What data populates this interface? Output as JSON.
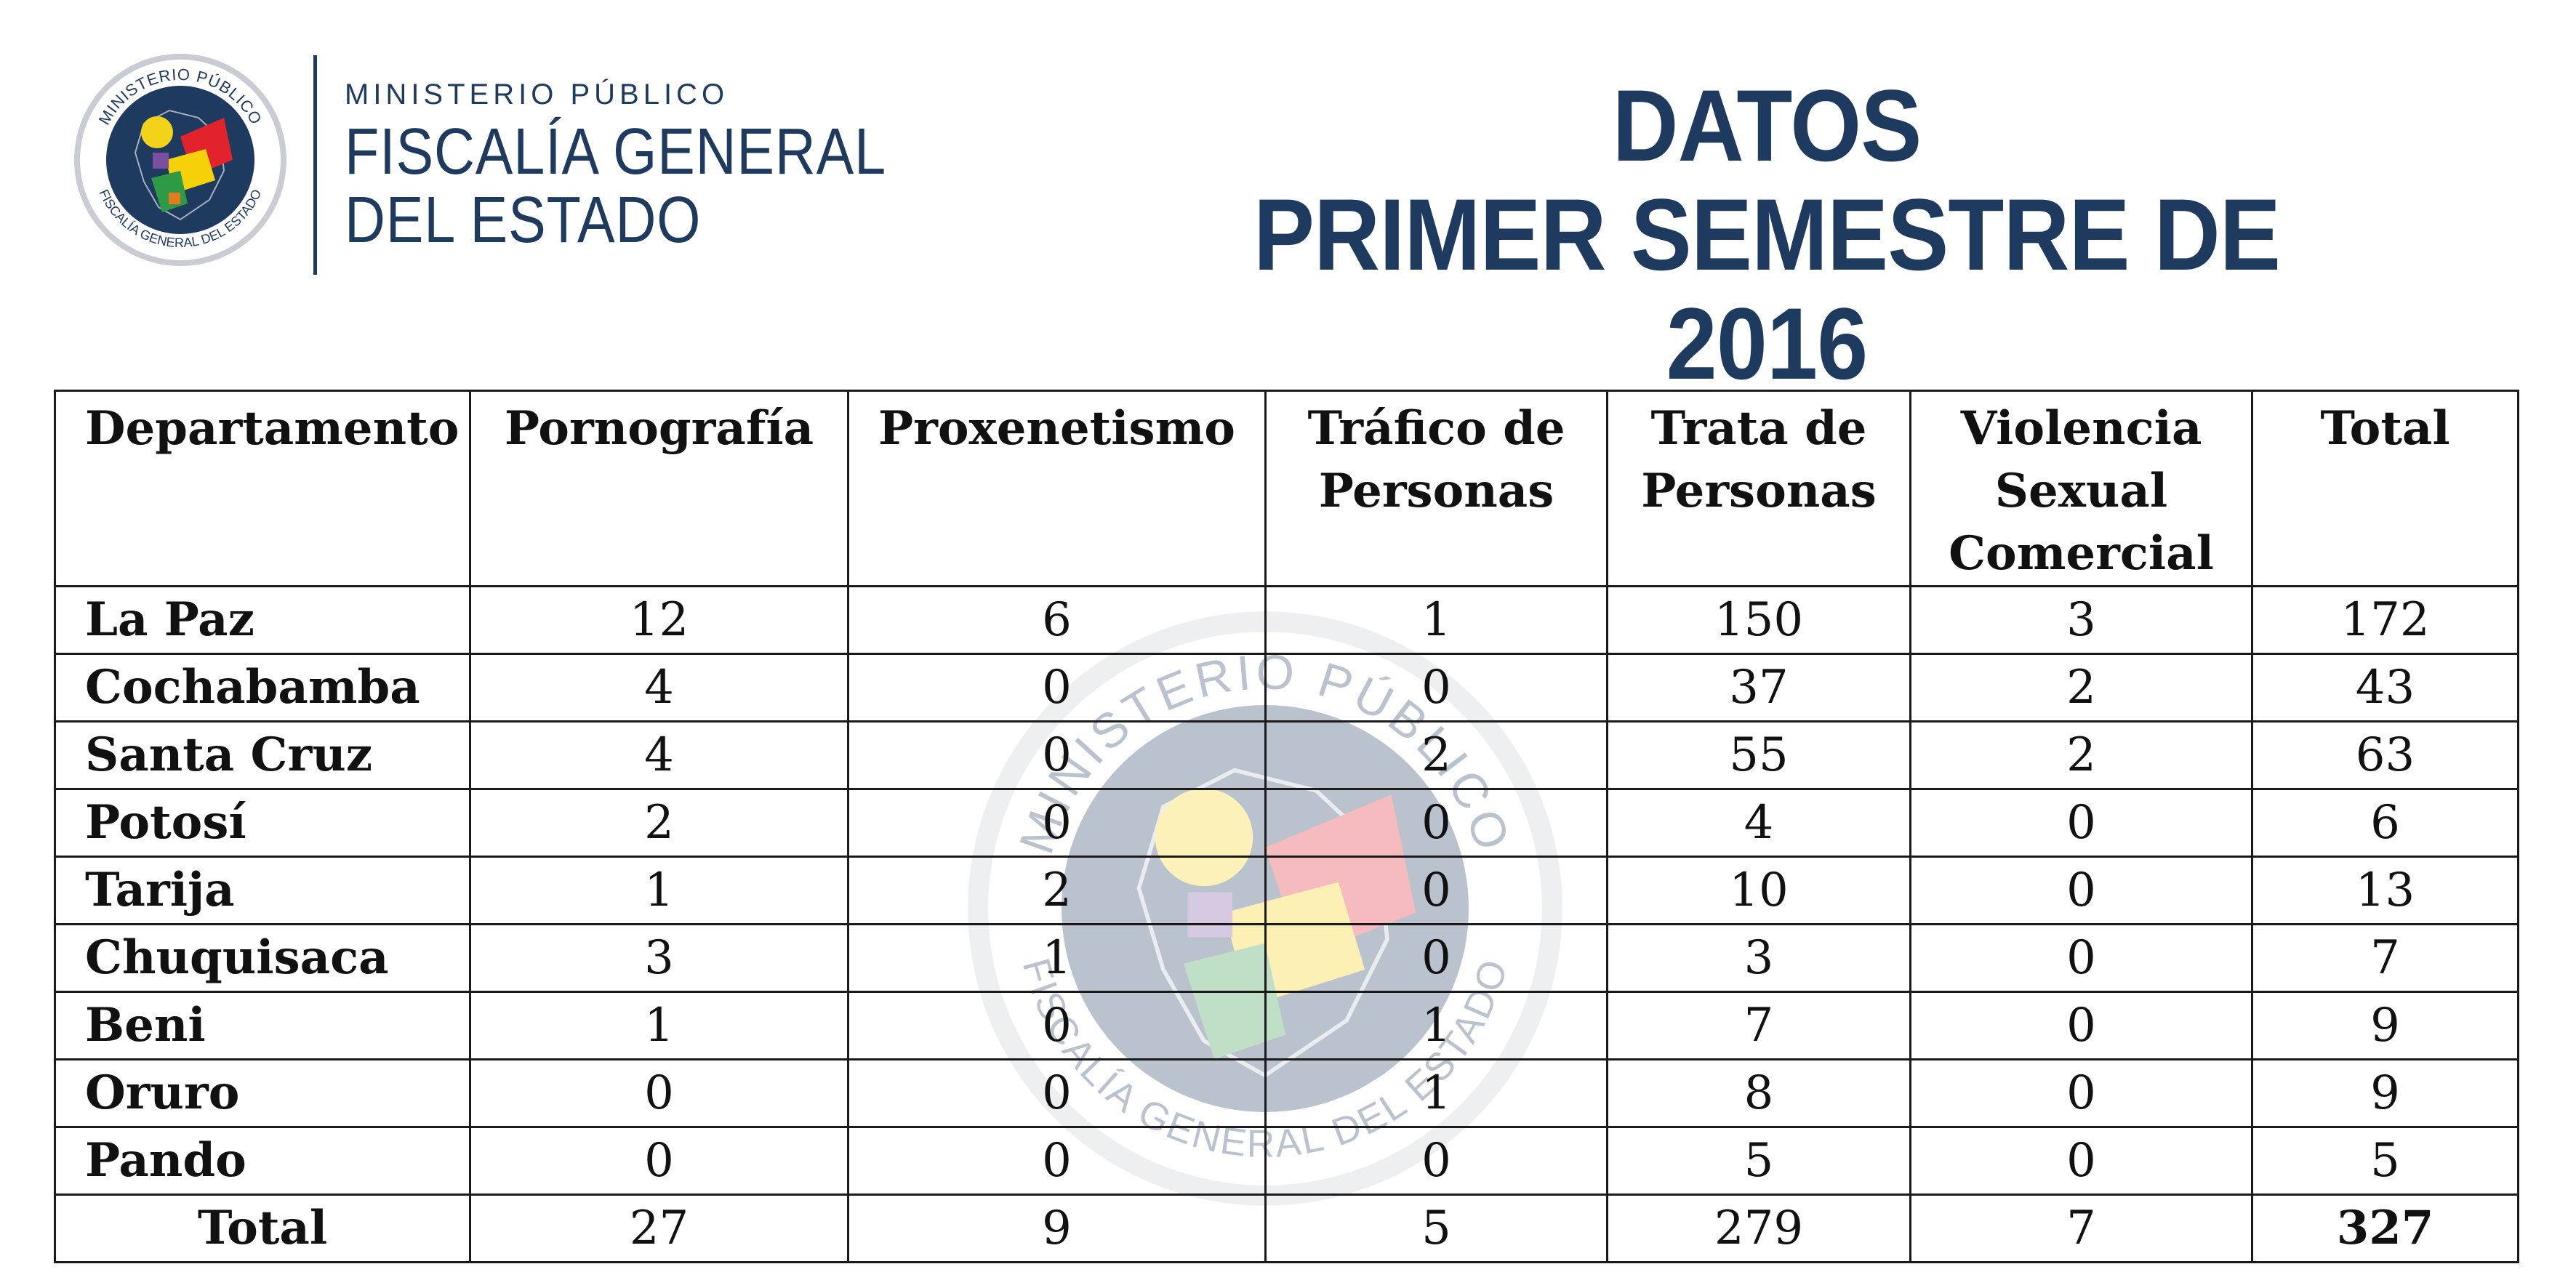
{
  "header": {
    "seal_text_top": "MINISTERIO PÚBLICO",
    "seal_text_bottom": "FISCALÍA GENERAL DEL ESTADO",
    "kicker": "MINISTERIO PÚBLICO",
    "org_line1": "FISCALÍA GENERAL",
    "org_line2": "DEL ESTADO",
    "title_line1": "DATOS",
    "title_line2": "PRIMER SEMESTRE DE 2016"
  },
  "colors": {
    "brand_navy": "#1f3a5f",
    "seal_silver": "#c9ccd3",
    "flag_red": "#e3232c",
    "flag_yellow": "#f6d10a",
    "flag_green": "#2f9a45",
    "sun_yellow": "#f3d21a"
  },
  "table": {
    "columns": [
      "Departamento",
      "Pornografía",
      "Proxenetismo",
      "Tráfico de Personas",
      "Trata de Personas",
      "Violencia Sexual Comercial",
      "Total"
    ],
    "header_lines": [
      [
        "Departamento"
      ],
      [
        "Pornografía"
      ],
      [
        "Proxenetismo"
      ],
      [
        "Tráfico de",
        "Personas"
      ],
      [
        "Trata de",
        "Personas"
      ],
      [
        "Violencia",
        "Sexual",
        "Comercial"
      ],
      [
        "Total"
      ]
    ],
    "rows": [
      [
        "La Paz",
        "12",
        "6",
        "1",
        "150",
        "3",
        "172"
      ],
      [
        "Cochabamba",
        "4",
        "0",
        "0",
        "37",
        "2",
        "43"
      ],
      [
        "Santa Cruz",
        "4",
        "0",
        "2",
        "55",
        "2",
        "63"
      ],
      [
        "Potosí",
        "2",
        "0",
        "0",
        "4",
        "0",
        "6"
      ],
      [
        "Tarija",
        "1",
        "2",
        "0",
        "10",
        "0",
        "13"
      ],
      [
        "Chuquisaca",
        "3",
        "1",
        "0",
        "3",
        "0",
        "7"
      ],
      [
        "Beni",
        "1",
        "0",
        "1",
        "7",
        "0",
        "9"
      ],
      [
        "Oruro",
        "0",
        "0",
        "1",
        "8",
        "0",
        "9"
      ],
      [
        "Pando",
        "0",
        "0",
        "0",
        "5",
        "0",
        "5"
      ],
      [
        "Total",
        "27",
        "9",
        "5",
        "279",
        "7",
        "327"
      ]
    ]
  }
}
